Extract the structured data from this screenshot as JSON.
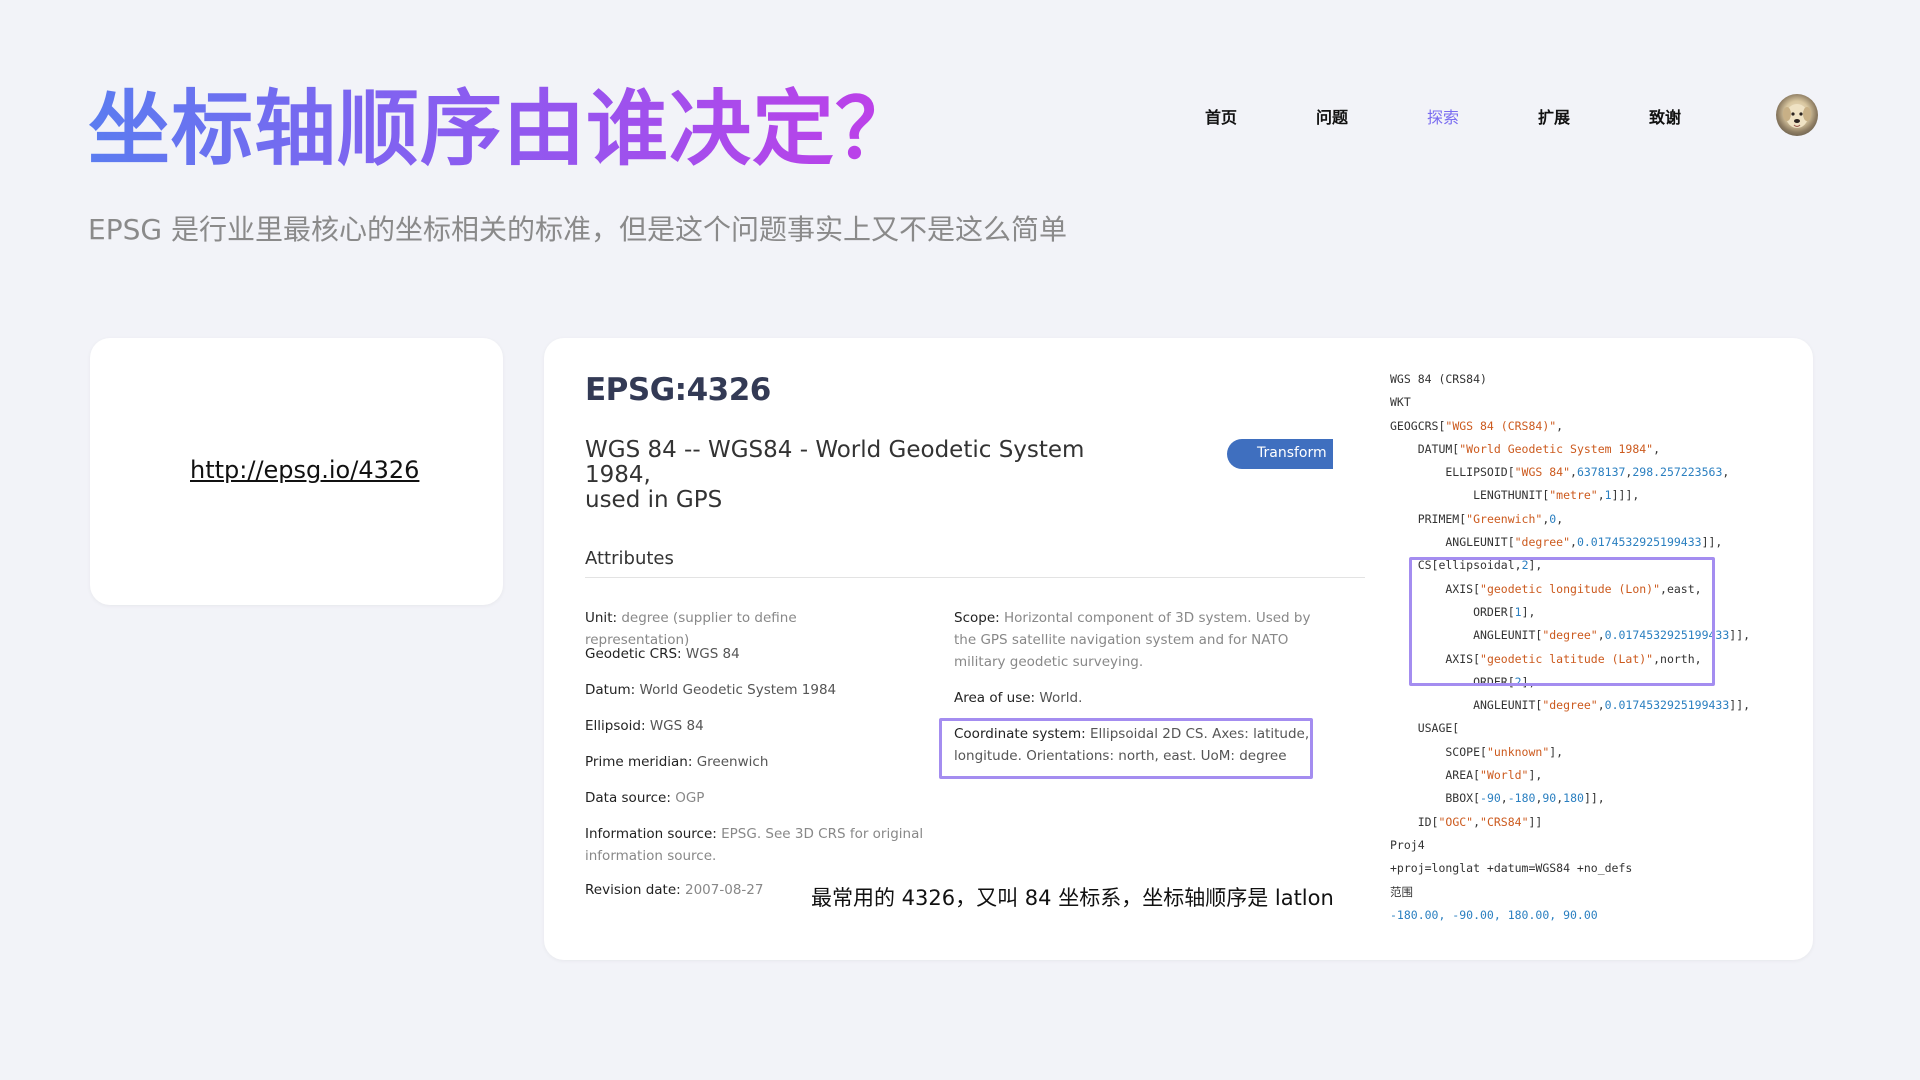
{
  "page": {
    "title": "坐标轴顺序由谁决定？",
    "subtitle": "EPSG 是行业里最核心的坐标相关的标准，但是这个问题事实上又不是这么简单"
  },
  "nav": {
    "items": [
      {
        "label": "首页",
        "active": false
      },
      {
        "label": "问题",
        "active": false
      },
      {
        "label": "探索",
        "active": true
      },
      {
        "label": "扩展",
        "active": false
      },
      {
        "label": "致谢",
        "active": false
      }
    ],
    "avatar": "dog-avatar"
  },
  "link_card": {
    "url": "http://epsg.io/4326"
  },
  "epsg": {
    "code": "EPSG:4326",
    "name_line1": "WGS 84 -- WGS84 - World Geodetic System 1984,",
    "name_line2": "used in GPS",
    "transform_label": "Transform",
    "attributes_heading": "Attributes",
    "left_attrs": [
      {
        "label": "Unit:",
        "value": "degree (supplier to define representation)"
      },
      {
        "label": "Geodetic CRS:",
        "value": "WGS 84"
      },
      {
        "label": "Datum:",
        "value": "World Geodetic System 1984"
      },
      {
        "label": "Ellipsoid:",
        "value": "WGS 84"
      },
      {
        "label": "Prime meridian:",
        "value": "Greenwich"
      },
      {
        "label": "Data source:",
        "value": "OGP"
      },
      {
        "label": "Information source:",
        "value": "EPSG. See 3D CRS for original information source."
      },
      {
        "label": "Revision date:",
        "value": "2007-08-27"
      }
    ],
    "right_attrs": [
      {
        "label": "Scope:",
        "value": "Horizontal component of 3D system. Used by the GPS satellite navigation system and for NATO military geodetic surveying."
      },
      {
        "label": "Area of use:",
        "value": "World."
      },
      {
        "label": "Coordinate system:",
        "value": "Ellipsoidal 2D CS. Axes: latitude, longitude. Orientations: north, east. UoM: degree"
      }
    ],
    "note": "最常用的 4326，又叫 84 坐标系，坐标轴顺序是 latlon"
  },
  "wkt_lines": [
    "WGS 84 (CRS84)",
    "WKT",
    "GEOGCRS[\"WGS 84 (CRS84)\",",
    "    DATUM[\"World Geodetic System 1984\",",
    "        ELLIPSOID[\"WGS 84\",6378137,298.257223563,",
    "            LENGTHUNIT[\"metre\",1]]],",
    "    PRIMEM[\"Greenwich\",0,",
    "        ANGLEUNIT[\"degree\",0.0174532925199433]],",
    "    CS[ellipsoidal,2],",
    "        AXIS[\"geodetic longitude (Lon)\",east,",
    "            ORDER[1],",
    "            ANGLEUNIT[\"degree\",0.0174532925199433]],",
    "        AXIS[\"geodetic latitude (Lat)\",north,",
    "            ORDER[2],",
    "            ANGLEUNIT[\"degree\",0.0174532925199433]],",
    "    USAGE[",
    "        SCOPE[\"unknown\"],",
    "        AREA[\"World\"],",
    "        BBOX[-90,-180,90,180]],",
    "    ID[\"OGC\",\"CRS84\"]]",
    "Proj4",
    "+proj=longlat +datum=WGS84 +no_defs",
    "范围",
    "-180.00, -90.00, 180.00, 90.00"
  ],
  "colors": {
    "accent": "#7a6cf0",
    "highlight_box": "#a48df0",
    "transform_button": "#3f6fbf",
    "wkt_string": "#cc5a1e",
    "wkt_number": "#2a7fc0"
  }
}
